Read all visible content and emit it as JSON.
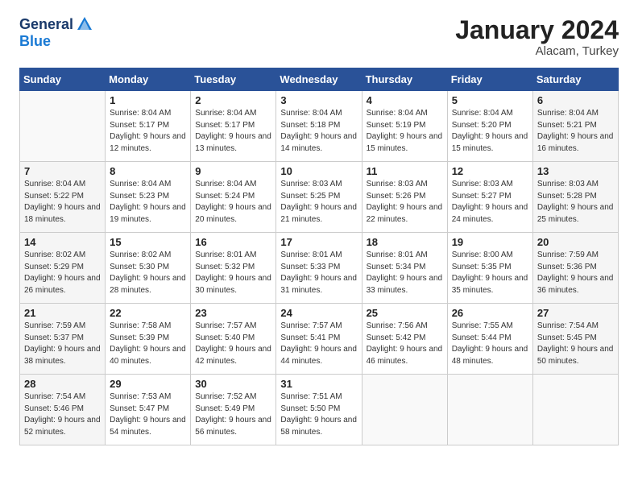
{
  "header": {
    "logo_general": "General",
    "logo_blue": "Blue",
    "month": "January 2024",
    "location": "Alacam, Turkey"
  },
  "days_of_week": [
    "Sunday",
    "Monday",
    "Tuesday",
    "Wednesday",
    "Thursday",
    "Friday",
    "Saturday"
  ],
  "weeks": [
    [
      {
        "day": "",
        "sunrise": "",
        "sunset": "",
        "daylight": ""
      },
      {
        "day": "1",
        "sunrise": "Sunrise: 8:04 AM",
        "sunset": "Sunset: 5:17 PM",
        "daylight": "Daylight: 9 hours and 12 minutes."
      },
      {
        "day": "2",
        "sunrise": "Sunrise: 8:04 AM",
        "sunset": "Sunset: 5:17 PM",
        "daylight": "Daylight: 9 hours and 13 minutes."
      },
      {
        "day": "3",
        "sunrise": "Sunrise: 8:04 AM",
        "sunset": "Sunset: 5:18 PM",
        "daylight": "Daylight: 9 hours and 14 minutes."
      },
      {
        "day": "4",
        "sunrise": "Sunrise: 8:04 AM",
        "sunset": "Sunset: 5:19 PM",
        "daylight": "Daylight: 9 hours and 15 minutes."
      },
      {
        "day": "5",
        "sunrise": "Sunrise: 8:04 AM",
        "sunset": "Sunset: 5:20 PM",
        "daylight": "Daylight: 9 hours and 15 minutes."
      },
      {
        "day": "6",
        "sunrise": "Sunrise: 8:04 AM",
        "sunset": "Sunset: 5:21 PM",
        "daylight": "Daylight: 9 hours and 16 minutes."
      }
    ],
    [
      {
        "day": "7",
        "sunrise": "Sunrise: 8:04 AM",
        "sunset": "Sunset: 5:22 PM",
        "daylight": "Daylight: 9 hours and 18 minutes."
      },
      {
        "day": "8",
        "sunrise": "Sunrise: 8:04 AM",
        "sunset": "Sunset: 5:23 PM",
        "daylight": "Daylight: 9 hours and 19 minutes."
      },
      {
        "day": "9",
        "sunrise": "Sunrise: 8:04 AM",
        "sunset": "Sunset: 5:24 PM",
        "daylight": "Daylight: 9 hours and 20 minutes."
      },
      {
        "day": "10",
        "sunrise": "Sunrise: 8:03 AM",
        "sunset": "Sunset: 5:25 PM",
        "daylight": "Daylight: 9 hours and 21 minutes."
      },
      {
        "day": "11",
        "sunrise": "Sunrise: 8:03 AM",
        "sunset": "Sunset: 5:26 PM",
        "daylight": "Daylight: 9 hours and 22 minutes."
      },
      {
        "day": "12",
        "sunrise": "Sunrise: 8:03 AM",
        "sunset": "Sunset: 5:27 PM",
        "daylight": "Daylight: 9 hours and 24 minutes."
      },
      {
        "day": "13",
        "sunrise": "Sunrise: 8:03 AM",
        "sunset": "Sunset: 5:28 PM",
        "daylight": "Daylight: 9 hours and 25 minutes."
      }
    ],
    [
      {
        "day": "14",
        "sunrise": "Sunrise: 8:02 AM",
        "sunset": "Sunset: 5:29 PM",
        "daylight": "Daylight: 9 hours and 26 minutes."
      },
      {
        "day": "15",
        "sunrise": "Sunrise: 8:02 AM",
        "sunset": "Sunset: 5:30 PM",
        "daylight": "Daylight: 9 hours and 28 minutes."
      },
      {
        "day": "16",
        "sunrise": "Sunrise: 8:01 AM",
        "sunset": "Sunset: 5:32 PM",
        "daylight": "Daylight: 9 hours and 30 minutes."
      },
      {
        "day": "17",
        "sunrise": "Sunrise: 8:01 AM",
        "sunset": "Sunset: 5:33 PM",
        "daylight": "Daylight: 9 hours and 31 minutes."
      },
      {
        "day": "18",
        "sunrise": "Sunrise: 8:01 AM",
        "sunset": "Sunset: 5:34 PM",
        "daylight": "Daylight: 9 hours and 33 minutes."
      },
      {
        "day": "19",
        "sunrise": "Sunrise: 8:00 AM",
        "sunset": "Sunset: 5:35 PM",
        "daylight": "Daylight: 9 hours and 35 minutes."
      },
      {
        "day": "20",
        "sunrise": "Sunrise: 7:59 AM",
        "sunset": "Sunset: 5:36 PM",
        "daylight": "Daylight: 9 hours and 36 minutes."
      }
    ],
    [
      {
        "day": "21",
        "sunrise": "Sunrise: 7:59 AM",
        "sunset": "Sunset: 5:37 PM",
        "daylight": "Daylight: 9 hours and 38 minutes."
      },
      {
        "day": "22",
        "sunrise": "Sunrise: 7:58 AM",
        "sunset": "Sunset: 5:39 PM",
        "daylight": "Daylight: 9 hours and 40 minutes."
      },
      {
        "day": "23",
        "sunrise": "Sunrise: 7:57 AM",
        "sunset": "Sunset: 5:40 PM",
        "daylight": "Daylight: 9 hours and 42 minutes."
      },
      {
        "day": "24",
        "sunrise": "Sunrise: 7:57 AM",
        "sunset": "Sunset: 5:41 PM",
        "daylight": "Daylight: 9 hours and 44 minutes."
      },
      {
        "day": "25",
        "sunrise": "Sunrise: 7:56 AM",
        "sunset": "Sunset: 5:42 PM",
        "daylight": "Daylight: 9 hours and 46 minutes."
      },
      {
        "day": "26",
        "sunrise": "Sunrise: 7:55 AM",
        "sunset": "Sunset: 5:44 PM",
        "daylight": "Daylight: 9 hours and 48 minutes."
      },
      {
        "day": "27",
        "sunrise": "Sunrise: 7:54 AM",
        "sunset": "Sunset: 5:45 PM",
        "daylight": "Daylight: 9 hours and 50 minutes."
      }
    ],
    [
      {
        "day": "28",
        "sunrise": "Sunrise: 7:54 AM",
        "sunset": "Sunset: 5:46 PM",
        "daylight": "Daylight: 9 hours and 52 minutes."
      },
      {
        "day": "29",
        "sunrise": "Sunrise: 7:53 AM",
        "sunset": "Sunset: 5:47 PM",
        "daylight": "Daylight: 9 hours and 54 minutes."
      },
      {
        "day": "30",
        "sunrise": "Sunrise: 7:52 AM",
        "sunset": "Sunset: 5:49 PM",
        "daylight": "Daylight: 9 hours and 56 minutes."
      },
      {
        "day": "31",
        "sunrise": "Sunrise: 7:51 AM",
        "sunset": "Sunset: 5:50 PM",
        "daylight": "Daylight: 9 hours and 58 minutes."
      },
      {
        "day": "",
        "sunrise": "",
        "sunset": "",
        "daylight": ""
      },
      {
        "day": "",
        "sunrise": "",
        "sunset": "",
        "daylight": ""
      },
      {
        "day": "",
        "sunrise": "",
        "sunset": "",
        "daylight": ""
      }
    ]
  ]
}
